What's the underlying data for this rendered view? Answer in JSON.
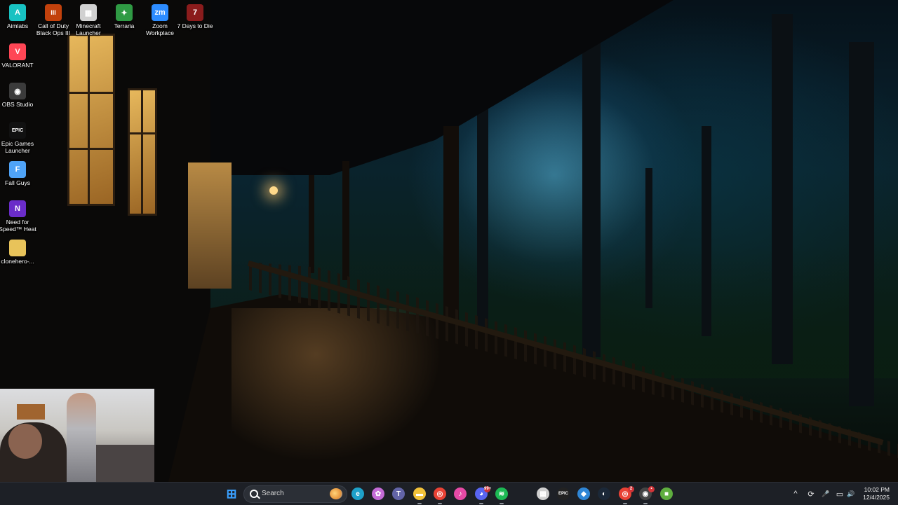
{
  "desktop": {
    "icons": [
      {
        "id": "aimlabs",
        "label": "Aimlabs",
        "color": "#18c2c2",
        "glyph": "A"
      },
      {
        "id": "cod",
        "label": "Call of Duty Black Ops III",
        "color": "#c2410c",
        "glyph": "III"
      },
      {
        "id": "minecraft-launcher",
        "label": "Minecraft Launcher",
        "color": "#d1d1d1",
        "glyph": "▦"
      },
      {
        "id": "terraria",
        "label": "Terraria",
        "color": "#2f9a44",
        "glyph": "✦"
      },
      {
        "id": "zoom",
        "label": "Zoom Workplace",
        "color": "#2d8cff",
        "glyph": "zm"
      },
      {
        "id": "7days",
        "label": "7 Days to Die",
        "color": "#8b1c1c",
        "glyph": "7"
      },
      {
        "id": "valorant",
        "label": "VALORANT",
        "color": "#ff4655",
        "glyph": "V"
      },
      {
        "id": "obs",
        "label": "OBS Studio",
        "color": "#3b3b3b",
        "glyph": "◉"
      },
      {
        "id": "epic",
        "label": "Epic Games Launcher",
        "color": "#111111",
        "glyph": "EPIC"
      },
      {
        "id": "fallguys",
        "label": "Fall Guys",
        "color": "#4fa3f7",
        "glyph": "F"
      },
      {
        "id": "nfs",
        "label": "Need for Speed™ Heat",
        "color": "#6a2cc9",
        "glyph": "N"
      },
      {
        "id": "clonehero",
        "label": "clonehero-...",
        "color": "#e8c35a",
        "glyph": ""
      }
    ]
  },
  "taskbar": {
    "search_placeholder": "Search",
    "apps": [
      {
        "name": "start",
        "glyph": "⊞",
        "color": "#3aa0ff"
      },
      {
        "name": "edge",
        "glyph": "e",
        "color": "#1ea1c9"
      },
      {
        "name": "copilot",
        "glyph": "✿",
        "color": "#c46bd6"
      },
      {
        "name": "teams",
        "glyph": "T",
        "color": "#6264a7"
      },
      {
        "name": "file-explorer",
        "glyph": "▬",
        "color": "#f2c23a"
      },
      {
        "name": "chrome",
        "glyph": "◎",
        "color": "#e94235"
      },
      {
        "name": "itunes",
        "glyph": "♪",
        "color": "#e64aa6"
      },
      {
        "name": "discord",
        "glyph": "◕",
        "color": "#5865f2",
        "badge": "99+"
      },
      {
        "name": "spotify",
        "glyph": "≋",
        "color": "#1db954"
      },
      {
        "name": "minecraft",
        "glyph": "▦",
        "color": "#cfcfcf"
      },
      {
        "name": "epic-games",
        "glyph": "EPIC",
        "color": "#222222"
      },
      {
        "name": "vscode",
        "glyph": "◆",
        "color": "#2f86d6"
      },
      {
        "name": "steam",
        "glyph": "◐",
        "color": "#1b2838"
      },
      {
        "name": "chrome-profile",
        "glyph": "◎",
        "color": "#e94235",
        "badge": "2"
      },
      {
        "name": "obs",
        "glyph": "◉",
        "color": "#444444",
        "badge": "•"
      },
      {
        "name": "minecraft-block",
        "glyph": "■",
        "color": "#5fae3f"
      }
    ],
    "tray": {
      "chevron": "^",
      "sync": "⟳",
      "mic": "🎤",
      "network": "▭",
      "volume": "🔊"
    },
    "clock": {
      "time": "10:02 PM",
      "date": "12/4/2025"
    }
  }
}
